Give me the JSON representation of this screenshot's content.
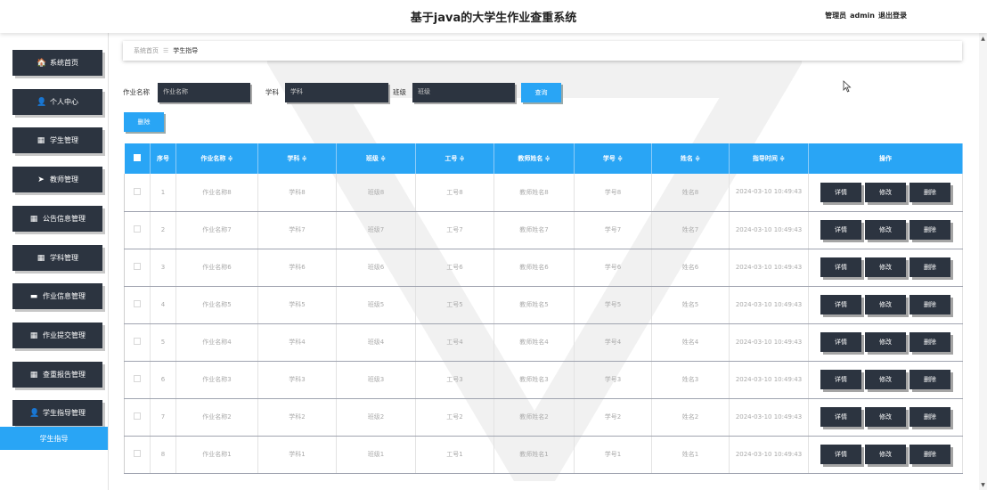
{
  "header": {
    "title": "基于java的大学生作业查重系统",
    "role": "管理员",
    "user": "admin",
    "logout": "退出登录"
  },
  "sidebar": {
    "items": [
      {
        "label": "系统首页",
        "icon": "home-icon",
        "glyph": "🏠"
      },
      {
        "label": "个人中心",
        "icon": "user-icon",
        "glyph": "👤"
      },
      {
        "label": "学生管理",
        "icon": "grid-icon",
        "glyph": "▦"
      },
      {
        "label": "教师管理",
        "icon": "send-icon",
        "glyph": "➤"
      },
      {
        "label": "公告信息管理",
        "icon": "grid-icon",
        "glyph": "▦"
      },
      {
        "label": "学科管理",
        "icon": "grid-icon",
        "glyph": "▦"
      },
      {
        "label": "作业信息管理",
        "icon": "document-icon",
        "glyph": "▬"
      },
      {
        "label": "作业提交管理",
        "icon": "grid-icon",
        "glyph": "▦"
      },
      {
        "label": "查重报告管理",
        "icon": "grid-icon",
        "glyph": "▦"
      },
      {
        "label": "学生指导管理",
        "icon": "user-icon",
        "glyph": "👤"
      }
    ],
    "active_sub": "学生指导"
  },
  "breadcrumb": {
    "home": "系统首页",
    "separator": "☰",
    "current": "学生指导"
  },
  "search": {
    "name_label": "作业名称",
    "name_placeholder": "作业名称",
    "subject_label": "学科",
    "subject_placeholder": "学科",
    "class_label": "班级",
    "class_placeholder": "班级",
    "search_button": "查询",
    "delete_button": "删除"
  },
  "table": {
    "headers": [
      "序号",
      "作业名称 ≑",
      "学科 ≑",
      "班级 ≑",
      "工号 ≑",
      "教师姓名 ≑",
      "学号 ≑",
      "姓名 ≑",
      "指导时间 ≑",
      "操作"
    ],
    "rows": [
      [
        "1",
        "作业名称8",
        "学科8",
        "班级8",
        "工号8",
        "教师姓名8",
        "学号8",
        "姓名8",
        "2024-03-10 10:49:43"
      ],
      [
        "2",
        "作业名称7",
        "学科7",
        "班级7",
        "工号7",
        "教师姓名7",
        "学号7",
        "姓名7",
        "2024-03-10 10:49:43"
      ],
      [
        "3",
        "作业名称6",
        "学科6",
        "班级6",
        "工号6",
        "教师姓名6",
        "学号6",
        "姓名6",
        "2024-03-10 10:49:43"
      ],
      [
        "4",
        "作业名称5",
        "学科5",
        "班级5",
        "工号5",
        "教师姓名5",
        "学号5",
        "姓名5",
        "2024-03-10 10:49:43"
      ],
      [
        "5",
        "作业名称4",
        "学科4",
        "班级4",
        "工号4",
        "教师姓名4",
        "学号4",
        "姓名4",
        "2024-03-10 10:49:43"
      ],
      [
        "6",
        "作业名称3",
        "学科3",
        "班级3",
        "工号3",
        "教师姓名3",
        "学号3",
        "姓名3",
        "2024-03-10 10:49:43"
      ],
      [
        "7",
        "作业名称2",
        "学科2",
        "班级2",
        "工号2",
        "教师姓名2",
        "学号2",
        "姓名2",
        "2024-03-10 10:49:43"
      ],
      [
        "8",
        "作业名称1",
        "学科1",
        "班级1",
        "工号1",
        "教师姓名1",
        "学号1",
        "姓名1",
        "2024-03-10 10:49:43"
      ]
    ],
    "actions": [
      "详情",
      "修改",
      "删除"
    ]
  },
  "colors": {
    "accent": "#29a5f5",
    "dark": "#2c3440"
  }
}
